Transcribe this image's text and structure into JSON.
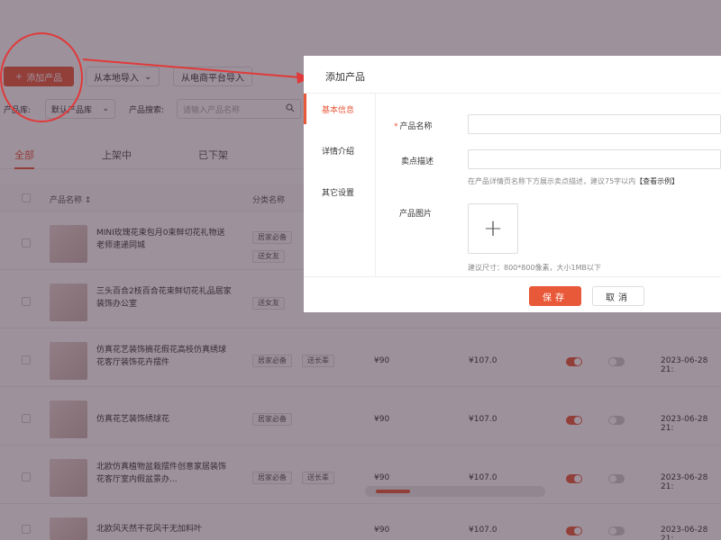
{
  "toolbar": {
    "add_product": "添加产品",
    "local_import": "从本地导入",
    "platform_import": "从电商平台导入"
  },
  "filters": {
    "library_label": "产品库:",
    "library_value": "默认产品库",
    "search_label": "产品搜索:",
    "search_placeholder": "请输入产品名称"
  },
  "tabs": [
    "全部",
    "上架中",
    "已下架"
  ],
  "table": {
    "headers": {
      "name": "产品名称",
      "category": "分类名称"
    },
    "rows": [
      {
        "name": "MINI玫瑰花束包月0束鲜切花礼物送老师速递同城",
        "tags": [
          "居家必备",
          "送女友"
        ],
        "price": "",
        "original": "",
        "date": ""
      },
      {
        "name": "三头百合2枝百合花束鲜切花礼品居家装饰办公室",
        "tags": [
          "送女友"
        ],
        "price": "",
        "original": "",
        "date": ""
      },
      {
        "name": "仿真花艺装饰摘花假花高枝仿真绣球花客厅装饰花卉摆件",
        "tags": [
          "居家必备",
          "送长辈"
        ],
        "price": "¥90",
        "original": "¥107.0",
        "date": "2023-06-28 21:"
      },
      {
        "name": "仿真花艺装饰绣球花",
        "tags": [
          "居家必备"
        ],
        "price": "¥90",
        "original": "¥107.0",
        "date": "2023-06-28 21:"
      },
      {
        "name": "北欧仿真植物盆栽摆件创意家居装饰花客厅室内假盆景办...",
        "tags": [
          "居家必备",
          "送长辈"
        ],
        "price": "¥90",
        "original": "¥107.0",
        "date": "2023-06-28 21:"
      },
      {
        "name": "北欧风天然干花风干无加料叶",
        "tags": [],
        "price": "¥90",
        "original": "¥107.0",
        "date": "2023-06-28 21:"
      }
    ]
  },
  "modal": {
    "title": "添加产品",
    "nav": [
      "基本信息",
      "详情介绍",
      "其它设置"
    ],
    "fields": {
      "name_label": "产品名称",
      "selling_label": "卖点描述",
      "selling_hint": "在产品详情页名称下方展示卖点描述，建议75字以内",
      "example_link": "【查看示例】",
      "image_label": "产品图片",
      "image_hint": "建议尺寸：800*800像素，大小1MB以下",
      "upload_plus": "+"
    },
    "save": "保存",
    "cancel": "取消"
  },
  "colors": {
    "accent": "#e8593a",
    "annotation": "#e03a3a",
    "overlay": "rgba(60,35,55,0.5)"
  }
}
